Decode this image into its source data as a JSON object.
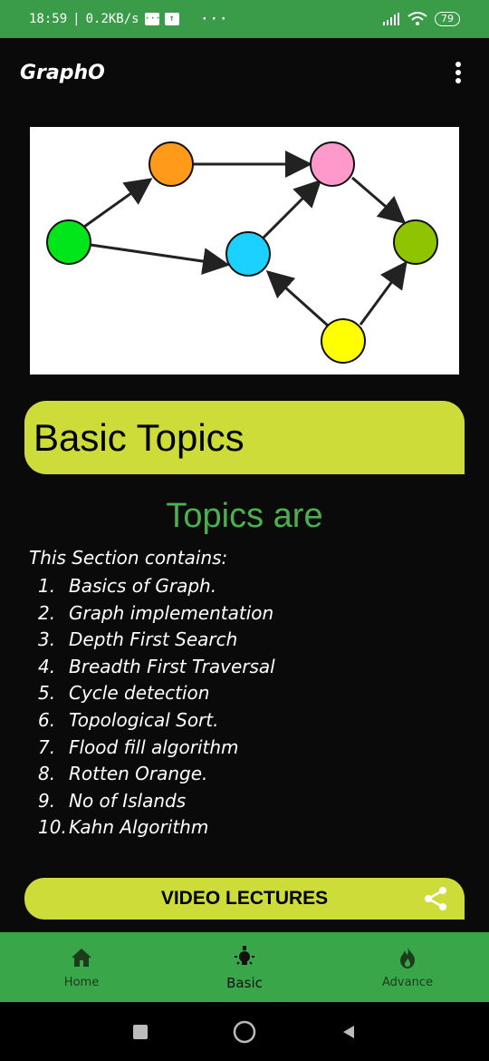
{
  "status_bar": {
    "time": "18:59",
    "separator": "|",
    "network_speed": "0.2KB/s",
    "dots": "···",
    "battery": "79"
  },
  "app_bar": {
    "title": "GraphO",
    "overflow_icon": "more-vert-icon"
  },
  "graph_illustration": {
    "nodes": [
      {
        "name": "green-node",
        "color": "#00e61a"
      },
      {
        "name": "orange-node",
        "color": "#ff9a1a"
      },
      {
        "name": "pink-node",
        "color": "#ff99cc"
      },
      {
        "name": "blue-node",
        "color": "#1ad1ff"
      },
      {
        "name": "olive-node",
        "color": "#8fc400"
      },
      {
        "name": "yellow-node",
        "color": "#ffff00"
      }
    ]
  },
  "banner": {
    "title": "Basic Topics",
    "color": "#cddc39"
  },
  "topics": {
    "heading": "Topics are",
    "heading_color": "#4caf50",
    "intro": "This Section contains:",
    "items": [
      {
        "num": "1.",
        "text": "Basics of Graph."
      },
      {
        "num": "2.",
        "text": "Graph implementation"
      },
      {
        "num": "3.",
        "text": "Depth First Search"
      },
      {
        "num": "4.",
        "text": "Breadth First Traversal"
      },
      {
        "num": "5.",
        "text": "Cycle detection"
      },
      {
        "num": "6.",
        "text": "Topological Sort."
      },
      {
        "num": "7.",
        "text": "Flood fill algorithm"
      },
      {
        "num": "8.",
        "text": "Rotten Orange."
      },
      {
        "num": "9.",
        "text": "No of Islands"
      },
      {
        "num": "10.",
        "text": "Kahn Algorithm"
      }
    ]
  },
  "video_lectures": {
    "label": "VIDEO LECTURES",
    "share_icon": "share-icon"
  },
  "bottom_nav": {
    "items": [
      {
        "label": "Home",
        "icon": "home-icon",
        "active": false
      },
      {
        "label": "Basic",
        "icon": "lightbulb-icon",
        "active": true
      },
      {
        "label": "Advance",
        "icon": "flame-icon",
        "active": false
      }
    ]
  },
  "system_nav": {
    "icons": [
      "recents-square-icon",
      "home-circle-icon",
      "back-triangle-icon"
    ]
  }
}
